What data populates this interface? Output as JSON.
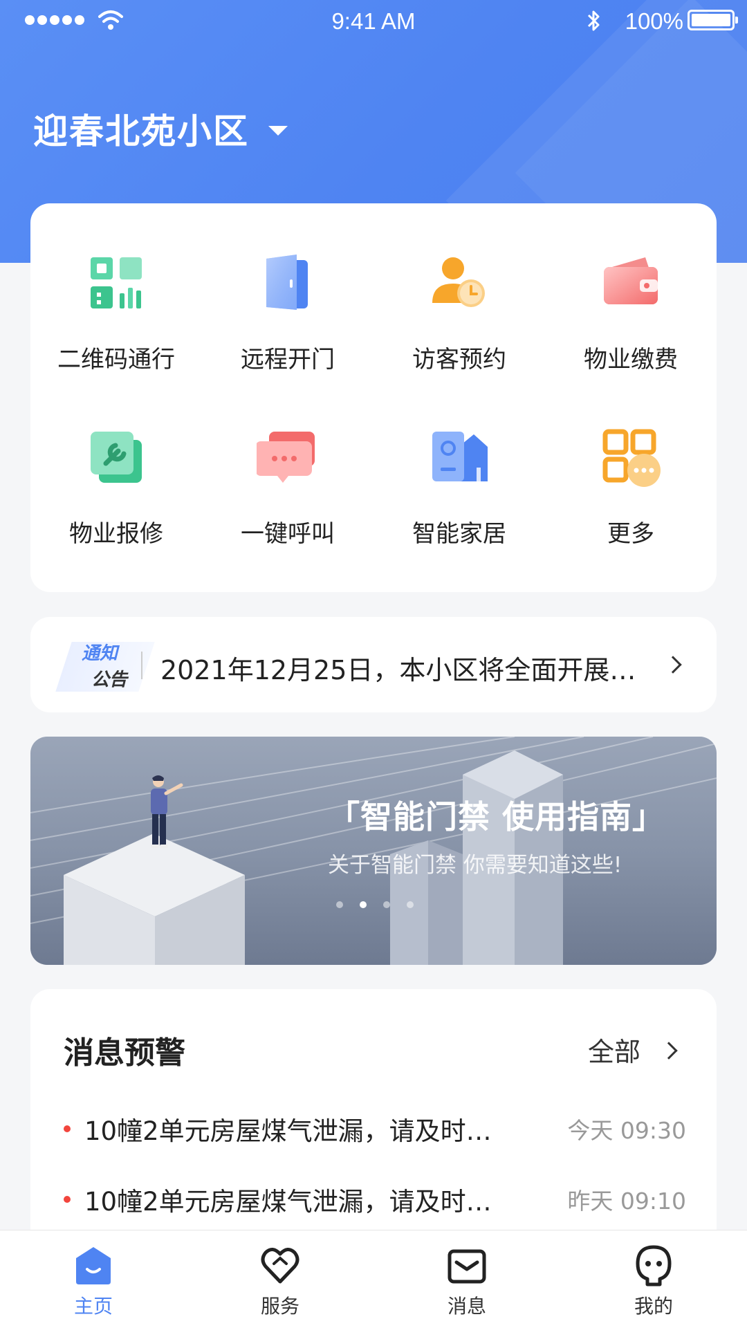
{
  "status_bar": {
    "time": "9:41 AM",
    "battery": "100%"
  },
  "header": {
    "community_name": "迎春北苑小区"
  },
  "services": [
    {
      "label": "二维码通行",
      "icon": "qr-code-icon"
    },
    {
      "label": "远程开门",
      "icon": "door-icon"
    },
    {
      "label": "访客预约",
      "icon": "visitor-clock-icon"
    },
    {
      "label": "物业缴费",
      "icon": "wallet-icon"
    },
    {
      "label": "物业报修",
      "icon": "wrench-icon"
    },
    {
      "label": "一键呼叫",
      "icon": "chat-call-icon"
    },
    {
      "label": "智能家居",
      "icon": "smart-home-icon"
    },
    {
      "label": "更多",
      "icon": "more-grid-icon"
    }
  ],
  "notice": {
    "badge_line1": "通知",
    "badge_line2": "公告",
    "text": "2021年12月25日，本小区将全面开展…"
  },
  "banner": {
    "title": "「智能门禁 使用指南」",
    "subtitle": "关于智能门禁 你需要知道这些!",
    "slide_count": 4,
    "active_slide": 2
  },
  "messages": {
    "title": "消息预警",
    "all_label": "全部",
    "items": [
      {
        "text": "10幢2单元房屋煤气泄漏，请及时…",
        "time": "今天 09:30"
      },
      {
        "text": "10幢2单元房屋煤气泄漏，请及时…",
        "time": "昨天 09:10"
      }
    ]
  },
  "tabs": [
    {
      "label": "主页",
      "icon": "home-icon",
      "active": true
    },
    {
      "label": "服务",
      "icon": "heart-icon",
      "active": false
    },
    {
      "label": "消息",
      "icon": "mail-icon",
      "active": false
    },
    {
      "label": "我的",
      "icon": "profile-icon",
      "active": false
    }
  ],
  "colors": {
    "primary": "#4f84f2",
    "alert_dot": "#f2453d"
  }
}
